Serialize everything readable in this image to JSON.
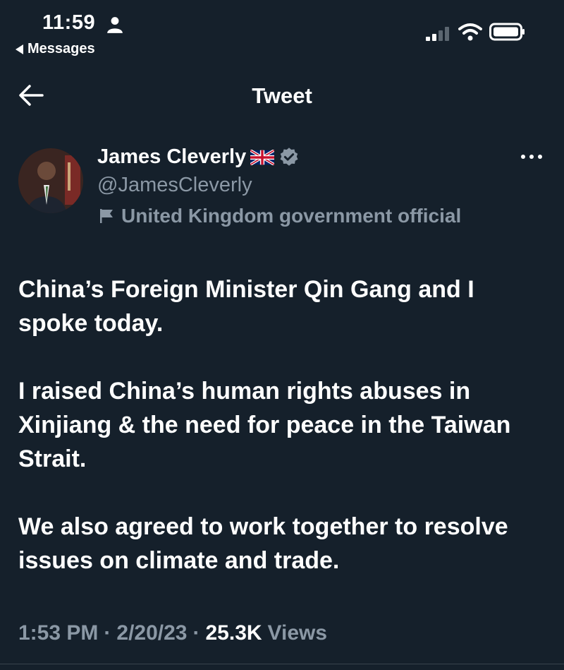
{
  "status_bar": {
    "time": "11:59",
    "back_app_label": "Messages",
    "icons": [
      "person-icon",
      "signal-icon",
      "wifi-icon",
      "battery-icon"
    ]
  },
  "header": {
    "title": "Tweet",
    "back_icon": "back-arrow-icon"
  },
  "author": {
    "name": "James Cleverly",
    "handle": "@JamesCleverly",
    "label": "United Kingdom government official",
    "flag_icon": "uk-flag-icon",
    "verified_icon": "verified-badge-icon",
    "more_icon": "more-options-icon"
  },
  "tweet": {
    "paragraphs": [
      "China’s Foreign Minister Qin Gang and I spoke today.",
      "I raised China’s human rights abuses in Xinjiang & the need for peace in the Taiwan Strait.",
      "We also agreed to work together to resolve issues on climate and trade."
    ],
    "time": "1:53 PM",
    "separator": "·",
    "date": "2/20/23",
    "views_count": "25.3K",
    "views_label": "Views"
  },
  "colors": {
    "background": "#15202b",
    "text": "#ffffff",
    "secondary": "#8b98a5",
    "verified": "#8b98a5"
  }
}
